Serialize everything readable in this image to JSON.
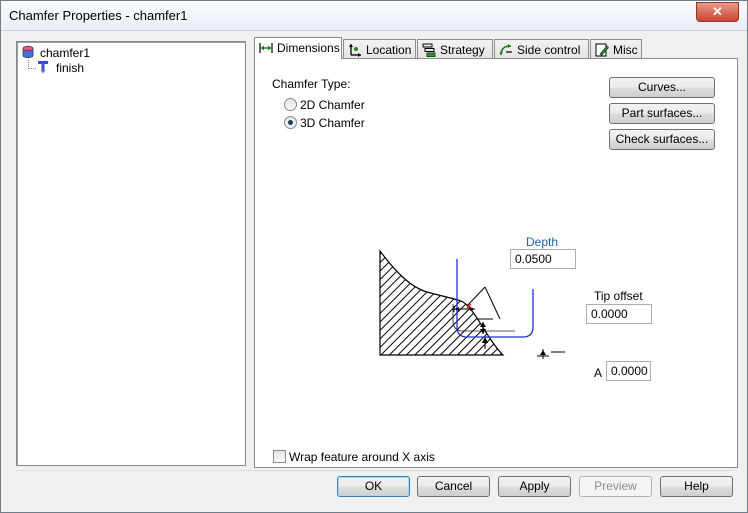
{
  "window": {
    "title": "Chamfer Properties - chamfer1",
    "close_glyph": "✕"
  },
  "tree": {
    "items": [
      {
        "label": "chamfer1",
        "icon": "cylinder-feature-icon"
      },
      {
        "label": "finish",
        "icon": "chamfer-tool-icon"
      }
    ]
  },
  "tabs": [
    {
      "label": "Dimensions",
      "icon": "dimensions-icon",
      "active": true
    },
    {
      "label": "Location",
      "icon": "location-icon"
    },
    {
      "label": "Strategy",
      "icon": "strategy-icon"
    },
    {
      "label": "Side control",
      "icon": "side-control-icon"
    },
    {
      "label": "Misc",
      "icon": "misc-icon"
    }
  ],
  "dimensions": {
    "chamfer_type_label": "Chamfer Type:",
    "options": [
      {
        "label": "2D Chamfer",
        "checked": false
      },
      {
        "label": "3D Chamfer",
        "checked": true
      }
    ],
    "buttons": {
      "curves": "Curves...",
      "part_surfaces": "Part surfaces...",
      "check_surfaces": "Check surfaces..."
    },
    "depth": {
      "label": "Depth",
      "value": "0.0500",
      "label_color": "#1f5fa8"
    },
    "tip_offset": {
      "label": "Tip offset",
      "value": "0.0000"
    },
    "angle": {
      "label": "A",
      "value": "0.0000"
    },
    "wrap": {
      "label": "Wrap feature around X axis",
      "checked": false
    }
  },
  "footer": {
    "ok": "OK",
    "cancel": "Cancel",
    "apply": "Apply",
    "preview": "Preview",
    "help": "Help"
  },
  "colors": {
    "tool_path": "#2233cc",
    "marker": "#cc2222"
  }
}
